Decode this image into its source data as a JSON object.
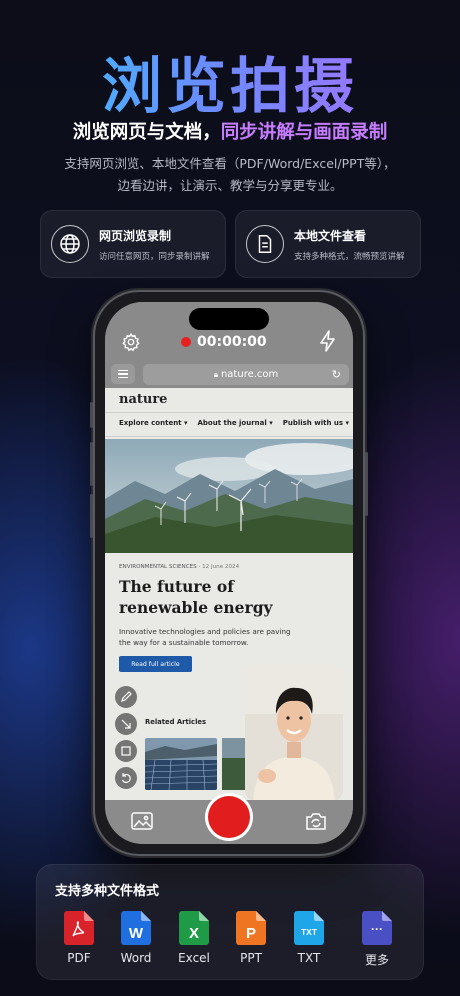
{
  "hero": {
    "title": "浏览拍摄",
    "subtitle_white_a": "浏览网页与文档，",
    "subtitle_purple": "同步讲解与画面录制",
    "desc_line1": "支持网页浏览、本地文件查看（PDF/Word/Excel/PPT等），",
    "desc_line2": "边看边讲，让演示、教学与分享更专业。"
  },
  "features": [
    {
      "title": "网页浏览录制",
      "desc": "访问任意网页，同步录制讲解",
      "icon": "globe-icon"
    },
    {
      "title": "本地文件查看",
      "desc": "支持多种格式，流畅预览讲解",
      "icon": "document-icon"
    }
  ],
  "recorder": {
    "timer": "00:00:00",
    "url": "nature.com"
  },
  "article": {
    "brand": "nature",
    "nav": [
      "Explore content",
      "About the journal",
      "Publish with us"
    ],
    "kicker": "ENVIRONMENTAL SCIENCES",
    "date": "12 June 2024",
    "headline_l1": "The future of",
    "headline_l2": "renewable energy",
    "standfirst": "Innovative technologies and policies are paving the way for a sustainable tomorrow.",
    "cta": "Read full article",
    "related": "Related Articles"
  },
  "formats": {
    "title": "支持多种文件格式",
    "items": [
      {
        "label": "PDF",
        "color": "#d8232a"
      },
      {
        "label": "Word",
        "color": "#1f6fe0"
      },
      {
        "label": "Excel",
        "color": "#1f9b47"
      },
      {
        "label": "PPT",
        "color": "#f07522"
      },
      {
        "label": "TXT",
        "color": "#1ea6e8",
        "glyph": "TXT"
      },
      {
        "label": "更多",
        "color": "#4a4fc4",
        "glyph": "···"
      }
    ]
  },
  "colors": {
    "accent_purple": "#c77dff",
    "record_red": "#e11d1d",
    "cta_blue": "#1e5aa8"
  }
}
